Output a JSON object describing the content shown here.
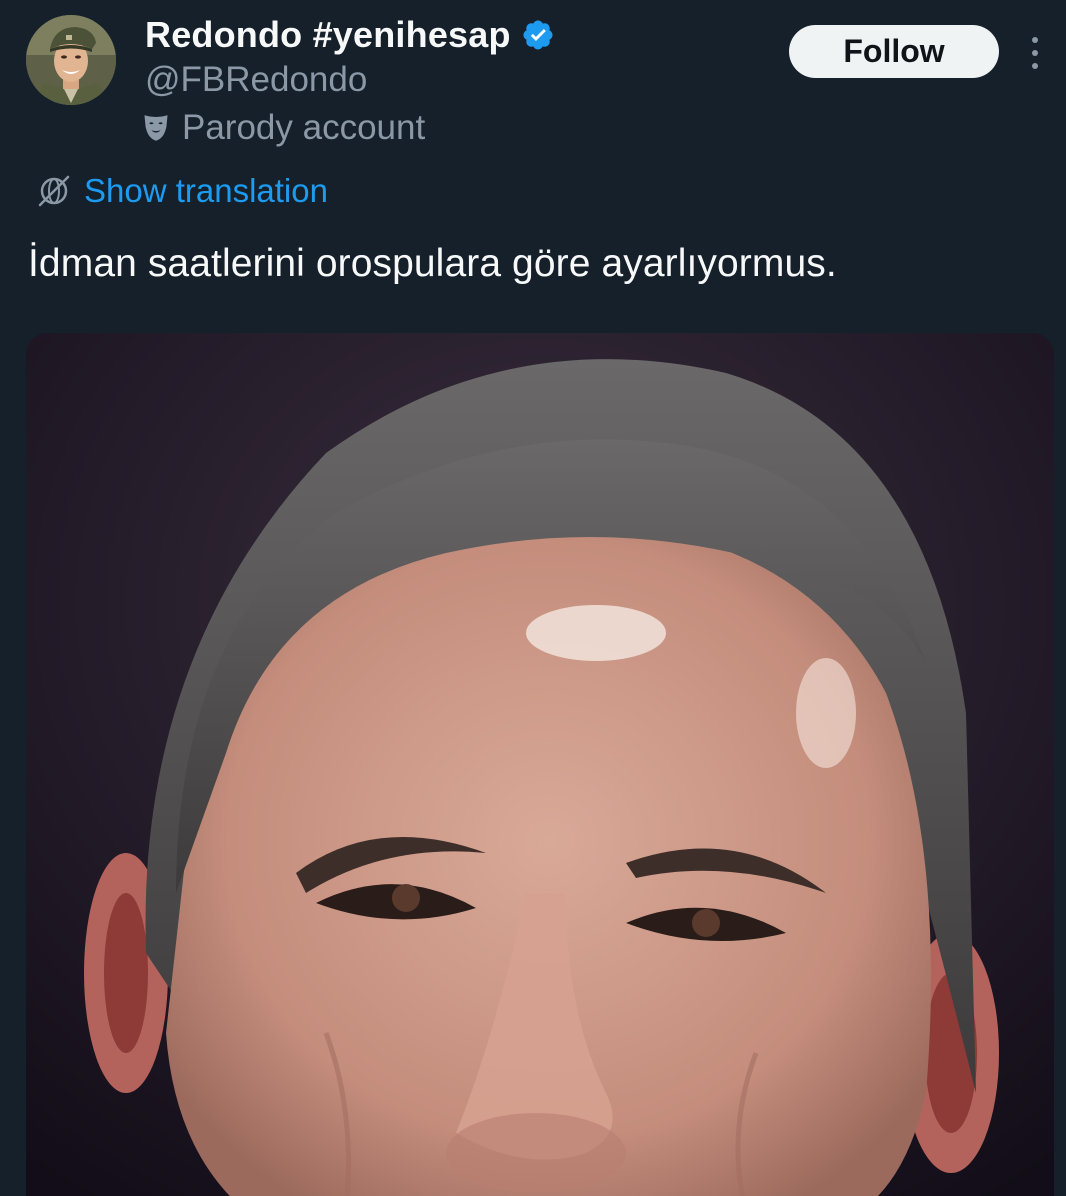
{
  "author": {
    "display_name": "Redondo #yenihesap",
    "handle": "@FBRedondo",
    "verified": true,
    "verified_icon": "verified-badge-icon",
    "label": "Parody account",
    "label_icon": "theater-mask-icon",
    "avatar_icon": "soldier-avatar"
  },
  "actions": {
    "follow_label": "Follow",
    "more_icon": "more-vertical-icon"
  },
  "translation": {
    "label": "Show translation",
    "icon": "globe-translate-icon"
  },
  "tweet": {
    "text": "İdman saatlerini orospulara göre ayarlıyormus."
  },
  "media": {
    "type": "photo",
    "description_icon": "portrait-photo"
  },
  "colors": {
    "background": "#15202b",
    "primary_text": "#f7f9f9",
    "secondary_text": "#8b98a5",
    "link": "#1d9bf0",
    "verified": "#1d9bf0",
    "follow_bg": "#eff3f4",
    "follow_text": "#0f1419"
  }
}
